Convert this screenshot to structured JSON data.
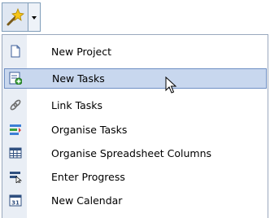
{
  "toolbar": {
    "dropdown_icon": "magic-wand-icon",
    "arrow_icon": "chevron-down-icon"
  },
  "menu": {
    "items": [
      {
        "label": "New Project",
        "icon": "new-document-icon"
      },
      {
        "label": "New Tasks",
        "icon": "new-tasks-icon",
        "highlighted": true
      },
      {
        "label": "Link Tasks",
        "icon": "link-icon"
      },
      {
        "label": "Organise Tasks",
        "icon": "organise-tasks-icon"
      },
      {
        "label": "Organise Spreadsheet Columns",
        "icon": "spreadsheet-columns-icon"
      },
      {
        "label": "Enter Progress",
        "icon": "progress-icon"
      },
      {
        "label": "New Calendar",
        "icon": "calendar-icon"
      }
    ]
  },
  "colors": {
    "highlight_bg": "#c8d7ee",
    "highlight_border": "#6f8fc4",
    "gutter": "#e9eef5"
  }
}
